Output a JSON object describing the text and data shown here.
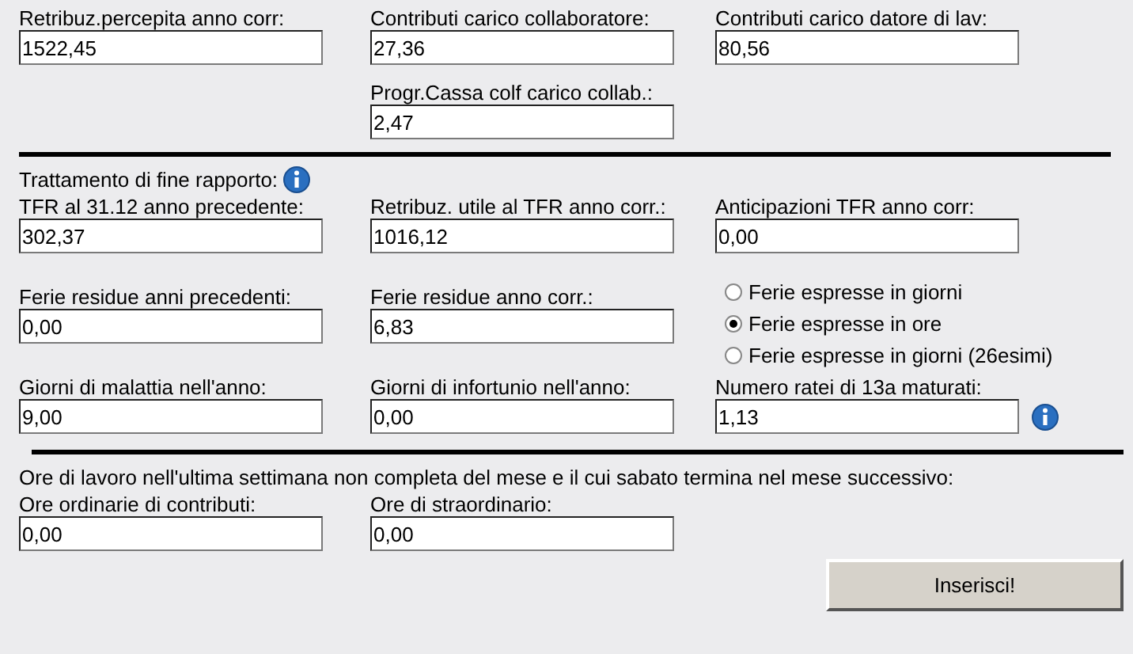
{
  "sections": [
    {
      "rows": [
        {
          "cells": [
            {
              "kind": "field",
              "label": "Retribuz.percepita anno corr:",
              "value": "1522,45"
            },
            {
              "kind": "field",
              "label": "Contributi carico collaboratore:",
              "value": "27,36"
            },
            {
              "kind": "field",
              "label": "Contributi carico datore di lav:",
              "value": "80,56"
            }
          ]
        },
        {
          "cells": [
            {
              "kind": "empty"
            },
            {
              "kind": "field",
              "label": "Progr.Cassa colf carico collab.:",
              "value": "2,47"
            }
          ]
        }
      ]
    },
    {
      "title": "Trattamento di fine rapporto:",
      "title_info": true,
      "rows": [
        {
          "cells": [
            {
              "kind": "field",
              "label": "TFR al 31.12 anno precedente:",
              "value": "302,37"
            },
            {
              "kind": "field",
              "label": "Retribuz. utile al TFR anno corr.:",
              "value": "1016,12"
            },
            {
              "kind": "field",
              "label": "Anticipazioni TFR anno corr:",
              "value": "0,00"
            }
          ]
        },
        {
          "cells": [
            {
              "kind": "field",
              "label": "Ferie residue anni precedenti:",
              "value": "0,00"
            },
            {
              "kind": "field",
              "label": "Ferie residue anno corr.:",
              "value": "6,83"
            },
            {
              "kind": "radios",
              "options": [
                {
                  "label": "Ferie espresse in giorni",
                  "selected": false
                },
                {
                  "label": "Ferie espresse in ore",
                  "selected": true
                },
                {
                  "label": "Ferie espresse in giorni (26esimi)",
                  "selected": false
                }
              ]
            }
          ]
        },
        {
          "cells": [
            {
              "kind": "field",
              "label": "Giorni di malattia nell'anno:",
              "value": "9,00"
            },
            {
              "kind": "field",
              "label": "Giorni di infortunio nell'anno:",
              "value": "0,00"
            },
            {
              "kind": "field",
              "label": "Numero ratei di 13a maturati:",
              "value": "1,13",
              "info": true
            }
          ]
        }
      ]
    },
    {
      "title": "Ore di lavoro nell'ultima settimana non completa del mese e il cui sabato termina nel mese successivo:",
      "rows": [
        {
          "cells": [
            {
              "kind": "field",
              "label": "Ore ordinarie di contributi:",
              "value": "0,00"
            },
            {
              "kind": "field",
              "label": "Ore di straordinario:",
              "value": "0,00"
            }
          ]
        }
      ]
    }
  ],
  "submit": "Inserisci!"
}
